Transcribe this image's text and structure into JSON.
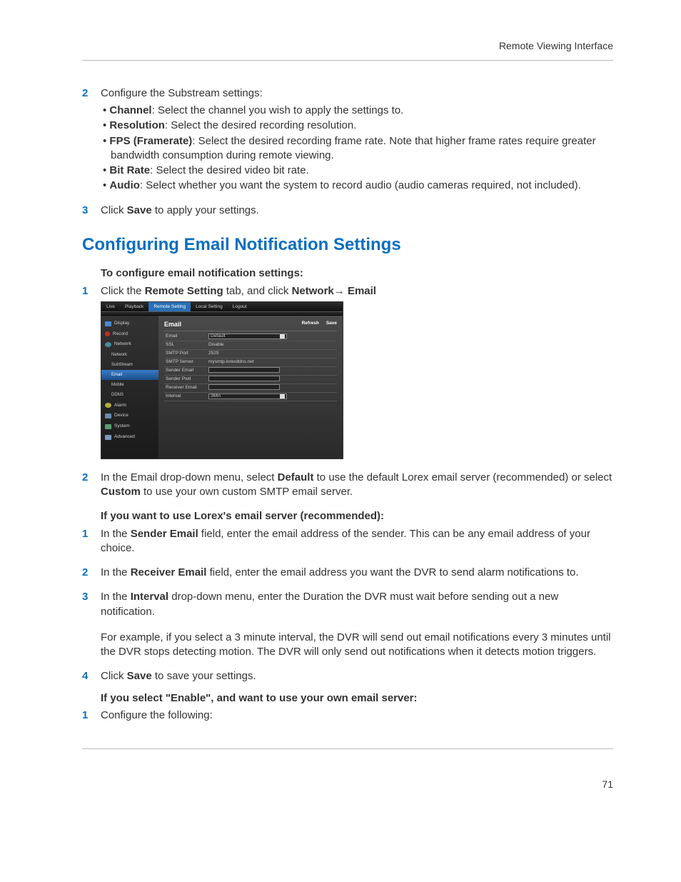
{
  "header": {
    "title": "Remote Viewing Interface"
  },
  "steps_a": {
    "s2": {
      "num": "2",
      "lead": "Configure the Substream settings:",
      "bullets": [
        {
          "b": "Channel",
          "t": ": Select the channel you wish to apply the settings to."
        },
        {
          "b": "Resolution",
          "t": ": Select the desired recording resolution."
        },
        {
          "b": "FPS (Framerate)",
          "t": ": Select the desired recording frame rate. Note that higher frame rates require greater bandwidth consumption during remote viewing."
        },
        {
          "b": "Bit Rate",
          "t": ": Select the desired video bit rate."
        },
        {
          "b": "Audio",
          "t": ": Select whether you want the system to record audio (audio cameras required, not included)."
        }
      ]
    },
    "s3": {
      "num": "3",
      "pre": "Click ",
      "bold": "Save",
      "post": " to apply your settings."
    }
  },
  "section_title": "Configuring Email Notification Settings",
  "sub1": "To configure email notification settings:",
  "steps_b": {
    "s1": {
      "num": "1",
      "pre": "Click the ",
      "b1": "Remote Setting",
      "mid": " tab, and click ",
      "b2": "Network",
      "arrow": "→ ",
      "b3": "Email"
    }
  },
  "screenshot": {
    "tabs": {
      "live": "Live",
      "playback": "Playback",
      "remote": "Remote Setting",
      "local": "Local Setting",
      "logout": "Logout"
    },
    "sidebar": {
      "display": "Display",
      "record": "Record",
      "network": "Network",
      "sub_network": "Network",
      "sub_substream": "SubStream",
      "sub_email": "Email",
      "sub_mobile": "Mobile",
      "sub_ddns": "DDNS",
      "alarm": "Alarm",
      "device": "Device",
      "system": "System",
      "advanced": "Advanced"
    },
    "panel": {
      "title": "Email",
      "refresh": "Refresh",
      "save": "Save",
      "rows": {
        "email_l": "Email",
        "email_v": "Default",
        "ssl_l": "SSL",
        "ssl_v": "Disable",
        "port_l": "SMTP Port",
        "port_v": "2525",
        "server_l": "SMTP Server",
        "server_v": "mysmtp.lorexddns.net",
        "sender_l": "Sender Email",
        "pwd_l": "Sender Pwd",
        "recv_l": "Receiver Email",
        "interval_l": "Interval",
        "interval_v": "3Min"
      }
    }
  },
  "steps_c": {
    "s2": {
      "num": "2",
      "t1": "In the Email drop-down menu, select ",
      "b1": "Default",
      "t2": " to use the default Lorex email server (recommended) or select ",
      "b2": "Custom",
      "t3": " to use your own custom SMTP email server."
    }
  },
  "sub2": "If you want to use Lorex's email server (recommended):",
  "steps_d": {
    "s1": {
      "num": "1",
      "t1": "In the ",
      "b1": "Sender Email",
      "t2": " field, enter the email address of the sender. This can be any email address of your choice."
    },
    "s2": {
      "num": "2",
      "t1": "In the ",
      "b1": "Receiver Email",
      "t2": " field, enter the email address you want the DVR to send alarm notifications to."
    },
    "s3": {
      "num": "3",
      "t1": "In the ",
      "b1": "Interval",
      "t2": " drop-down menu, enter the Duration the DVR must wait before sending out a new notification."
    },
    "s3_para": "For example, if you select a 3 minute interval, the DVR will send out email notifications every 3 minutes until the DVR stops detecting motion. The DVR will only send out notifications when it detects motion triggers.",
    "s4": {
      "num": "4",
      "t1": "Click ",
      "b1": "Save",
      "t2": " to save your settings."
    }
  },
  "sub3": "If you select \"Enable\", and want to use your own email server:",
  "steps_e": {
    "s1": {
      "num": "1",
      "t1": "Configure the following:"
    }
  },
  "footer": {
    "page": "71"
  }
}
